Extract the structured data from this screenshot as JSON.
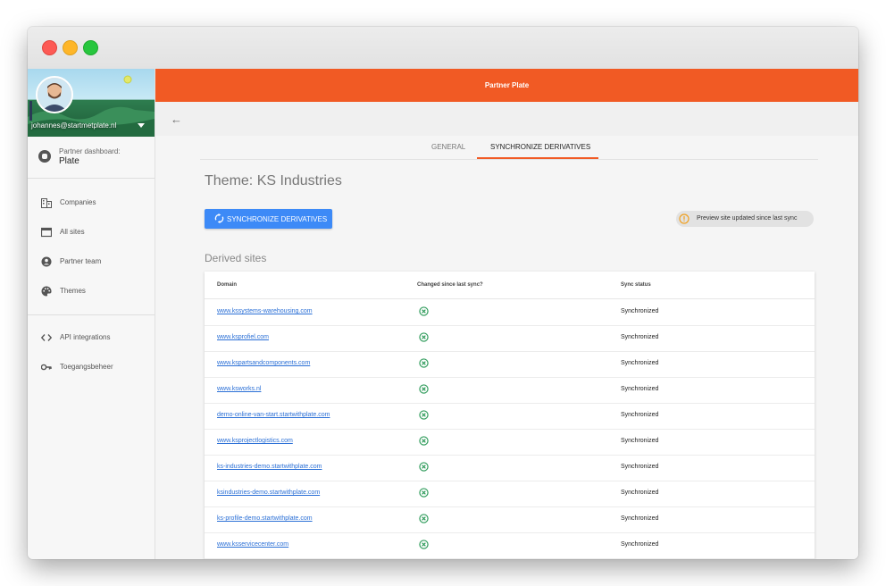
{
  "window": {
    "buttons": [
      "close",
      "minimize",
      "maximize"
    ]
  },
  "sidebar": {
    "profile": {
      "email": "johannes@startmetplate.nl"
    },
    "dashboard": {
      "label": "Partner dashboard:",
      "name": "Plate"
    },
    "items": [
      {
        "label": "Companies",
        "icon": "companies-icon"
      },
      {
        "label": "All sites",
        "icon": "sites-icon"
      },
      {
        "label": "Partner team",
        "icon": "team-icon"
      },
      {
        "label": "Themes",
        "icon": "palette-icon"
      },
      {
        "label": "API integrations",
        "icon": "code-icon"
      },
      {
        "label": "Toegangsbeheer",
        "icon": "key-icon"
      }
    ]
  },
  "header": {
    "title": "Partner Plate"
  },
  "tabs": [
    {
      "label": "GENERAL",
      "active": false
    },
    {
      "label": "SYNCHRONIZE DERIVATIVES",
      "active": true
    }
  ],
  "main": {
    "theme_title": "Theme: KS Industries",
    "sync_button": "SYNCHRONIZE DERIVATIVES",
    "status_notice": "Preview site updated since last sync",
    "derived_title": "Derived sites"
  },
  "table": {
    "columns": [
      "Domain",
      "Changed since last sync?",
      "Sync status"
    ],
    "rows": [
      {
        "domain": "www.kssystems-warehousing.com",
        "status": "Synchronized"
      },
      {
        "domain": "www.ksprofiel.com",
        "status": "Synchronized"
      },
      {
        "domain": "www.kspartsandcomponents.com",
        "status": "Synchronized"
      },
      {
        "domain": "www.ksworks.nl",
        "status": "Synchronized"
      },
      {
        "domain": "demo-online-van-start.startwithplate.com",
        "status": "Synchronized"
      },
      {
        "domain": "www.ksprojectlogistics.com",
        "status": "Synchronized"
      },
      {
        "domain": "ks-industries-demo.startwithplate.com",
        "status": "Synchronized"
      },
      {
        "domain": "ksindustries-demo.startwithplate.com",
        "status": "Synchronized"
      },
      {
        "domain": "ks-profile-demo.startwithplate.com",
        "status": "Synchronized"
      },
      {
        "domain": "www.ksservicecenter.com",
        "status": "Synchronized"
      }
    ]
  },
  "colors": {
    "accent": "#f15a24",
    "primary_button": "#3d8af7",
    "link": "#2a6fd6",
    "changed_icon": "#2e9b5a",
    "warning_icon": "#f0a020"
  }
}
